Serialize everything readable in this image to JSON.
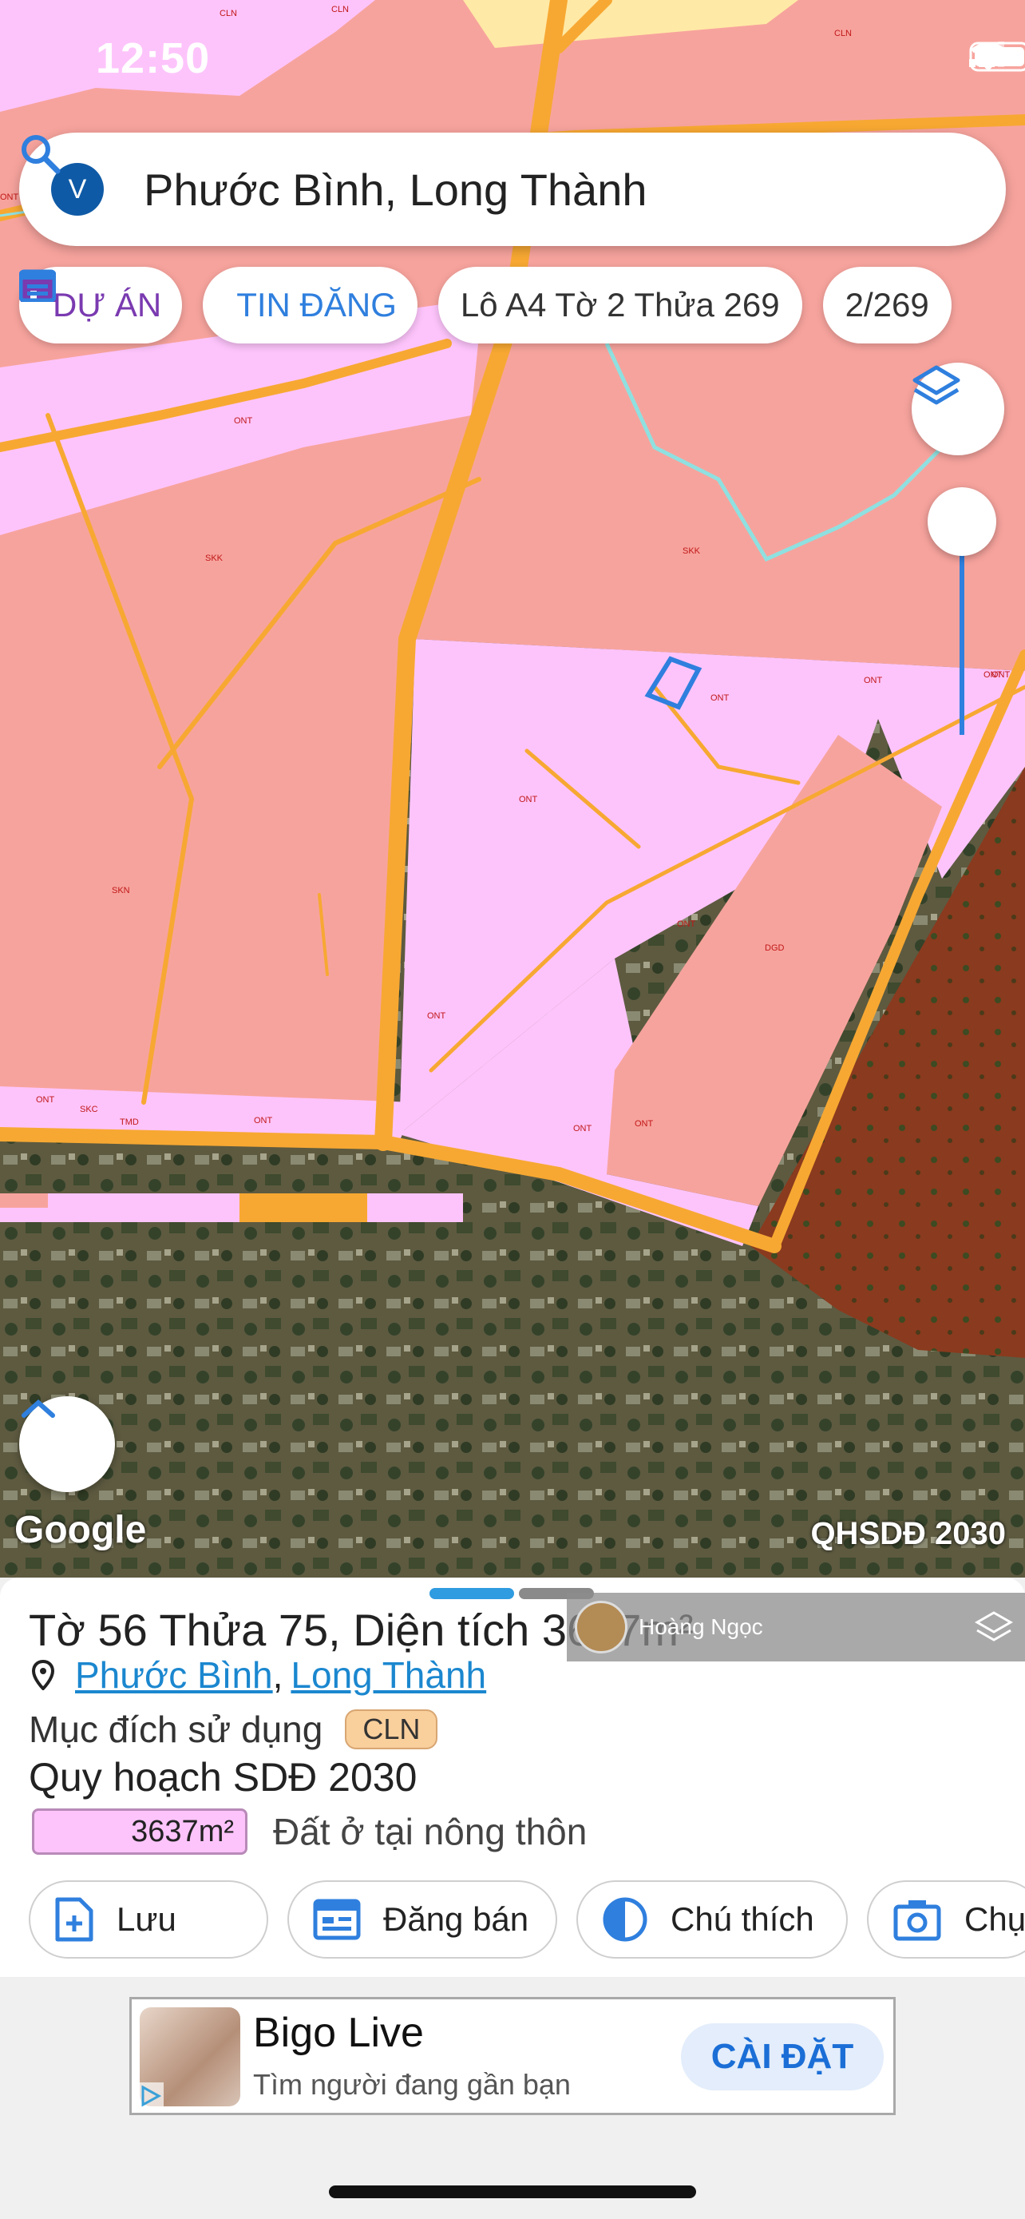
{
  "status_bar": {
    "time": "12:50"
  },
  "search": {
    "badge": "V",
    "query": "Phước Bình, Long Thành"
  },
  "chips": [
    {
      "label": "DỰ ÁN",
      "icon": "project-house-icon"
    },
    {
      "label": "TIN ĐĂNG",
      "icon": "listing-calendar-icon"
    },
    {
      "label": "Lô A4 Tờ 2 Thửa 269"
    },
    {
      "label": "2/269"
    }
  ],
  "map": {
    "google_label": "Google",
    "overlay_label": "QHSDĐ 2030",
    "zone_labels": [
      "CLN",
      "CLN",
      "CLN",
      "ONT",
      "ONT",
      "SKK",
      "SKK",
      "ONT",
      "ONT",
      "ONT",
      "ONT",
      "SKN",
      "ONT",
      "DGD",
      "ONT",
      "ONT",
      "SKC",
      "TMD",
      "ONT",
      "ONT",
      "ONT",
      "ONT"
    ]
  },
  "panel": {
    "title": "Tờ 56 Thửa 75, Diện tích 3637m²",
    "watermark": "Hoàng Ngọc",
    "location": {
      "ward": "Phước Bình",
      "district": "Long Thành"
    },
    "purpose_label": "Mục đích sử dụng",
    "purpose_tag": "CLN",
    "plan_title": "Quy hoạch SDĐ 2030",
    "plan_area": "3637m²",
    "plan_desc": "Đất ở tại nông thôn",
    "actions": [
      {
        "label": "Lưu",
        "icon": "save-document-icon"
      },
      {
        "label": "Đăng bán",
        "icon": "post-sale-icon"
      },
      {
        "label": "Chú thích",
        "icon": "legend-contrast-icon"
      },
      {
        "label": "Chụ",
        "icon": "camera-icon"
      }
    ]
  },
  "ad": {
    "name": "Bigo Live",
    "subtitle": "Tìm người đang gần bạn",
    "cta": "CÀI ĐẶT"
  },
  "colors": {
    "accent": "#2f7fde",
    "zone_pink": "#fdc4fb",
    "zone_salmon": "#f7a39d",
    "road": "#f7a832",
    "tag": "#f9cf9c"
  }
}
